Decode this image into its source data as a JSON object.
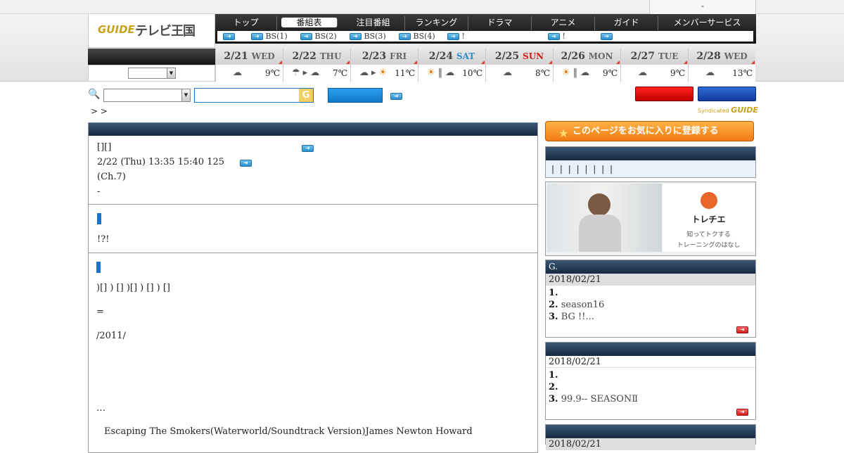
{
  "topbar": {
    "user_text": "-"
  },
  "logo": {
    "guide": "GUIDE",
    "title": "テレビ王国"
  },
  "nav": {
    "tabs": [
      "トップ",
      "番組表",
      "注目番組",
      "ランキング",
      "ドラマ",
      "アニメ",
      "ガイド",
      "メンバーサービス"
    ],
    "active_tab": "番組表",
    "sub_items": [
      "",
      "BS(1)",
      "BS(2)",
      "BS(3)",
      "BS(4)",
      "!",
      "!",
      ""
    ]
  },
  "dates": [
    {
      "date": "2/21",
      "weekday": "WED",
      "weather": "cloud",
      "temp": "9℃",
      "wd_color": "#666666"
    },
    {
      "date": "2/22",
      "weekday": "THU",
      "weather": "rain-to-cloud",
      "temp": "7℃",
      "wd_color": "#666666"
    },
    {
      "date": "2/23",
      "weekday": "FRI",
      "weather": "cloud-to-sun",
      "temp": "11℃",
      "wd_color": "#666666"
    },
    {
      "date": "2/24",
      "weekday": "SAT",
      "weather": "sun-or-cloud",
      "temp": "10℃",
      "wd_color": "#2a8fd0"
    },
    {
      "date": "2/25",
      "weekday": "SUN",
      "weather": "cloud",
      "temp": "8℃",
      "wd_color": "#d21c1c"
    },
    {
      "date": "2/26",
      "weekday": "MON",
      "weather": "sun-or-cloud",
      "temp": "9℃",
      "wd_color": "#666666"
    },
    {
      "date": "2/27",
      "weekday": "TUE",
      "weather": "cloud",
      "temp": "9℃",
      "wd_color": "#666666"
    },
    {
      "date": "2/28",
      "weekday": "WED",
      "weather": "cloud",
      "temp": "13℃",
      "wd_color": "#666666"
    }
  ],
  "crumb": ">  >",
  "syndicated": {
    "label": "Syndicated",
    "brand": "GUIDE"
  },
  "program": {
    "title_line": "[][]",
    "time_line": "2/22 (Thu) 13:35  15:40 125",
    "channel_line": "(Ch.7)",
    "dash_line": " -",
    "section2_text": "!?!",
    "section3_cast": ")[]  )  []  )[]  )  []  )  []",
    "section3_eq": "=",
    "section3_year": "/2011/",
    "section3_more": "…",
    "music_line": "Escaping The Smokers(Waterworld/Soundtrack Version)James Newton Howard"
  },
  "sidebar": {
    "fav_label": "このページをお気に入りに登録する",
    "links_line": "| | | | | | | |",
    "ad": {
      "brand": "トレチエ",
      "line1": "知ってトクする",
      "line2": "トレーニングのはなし"
    },
    "box1": {
      "head": "G.",
      "date": "2018/02/21",
      "ranks": [
        {
          "n": "1.",
          "t": ""
        },
        {
          "n": "2.",
          "t": "season16"
        },
        {
          "n": "3.",
          "t": "BG !!..."
        }
      ]
    },
    "box2": {
      "head": "",
      "date": "2018/02/21",
      "ranks": [
        {
          "n": "1.",
          "t": ""
        },
        {
          "n": "2.",
          "t": ""
        },
        {
          "n": "3.",
          "t": "99.9-- SEASONⅡ"
        }
      ]
    },
    "box3": {
      "date": "2018/02/21"
    }
  }
}
